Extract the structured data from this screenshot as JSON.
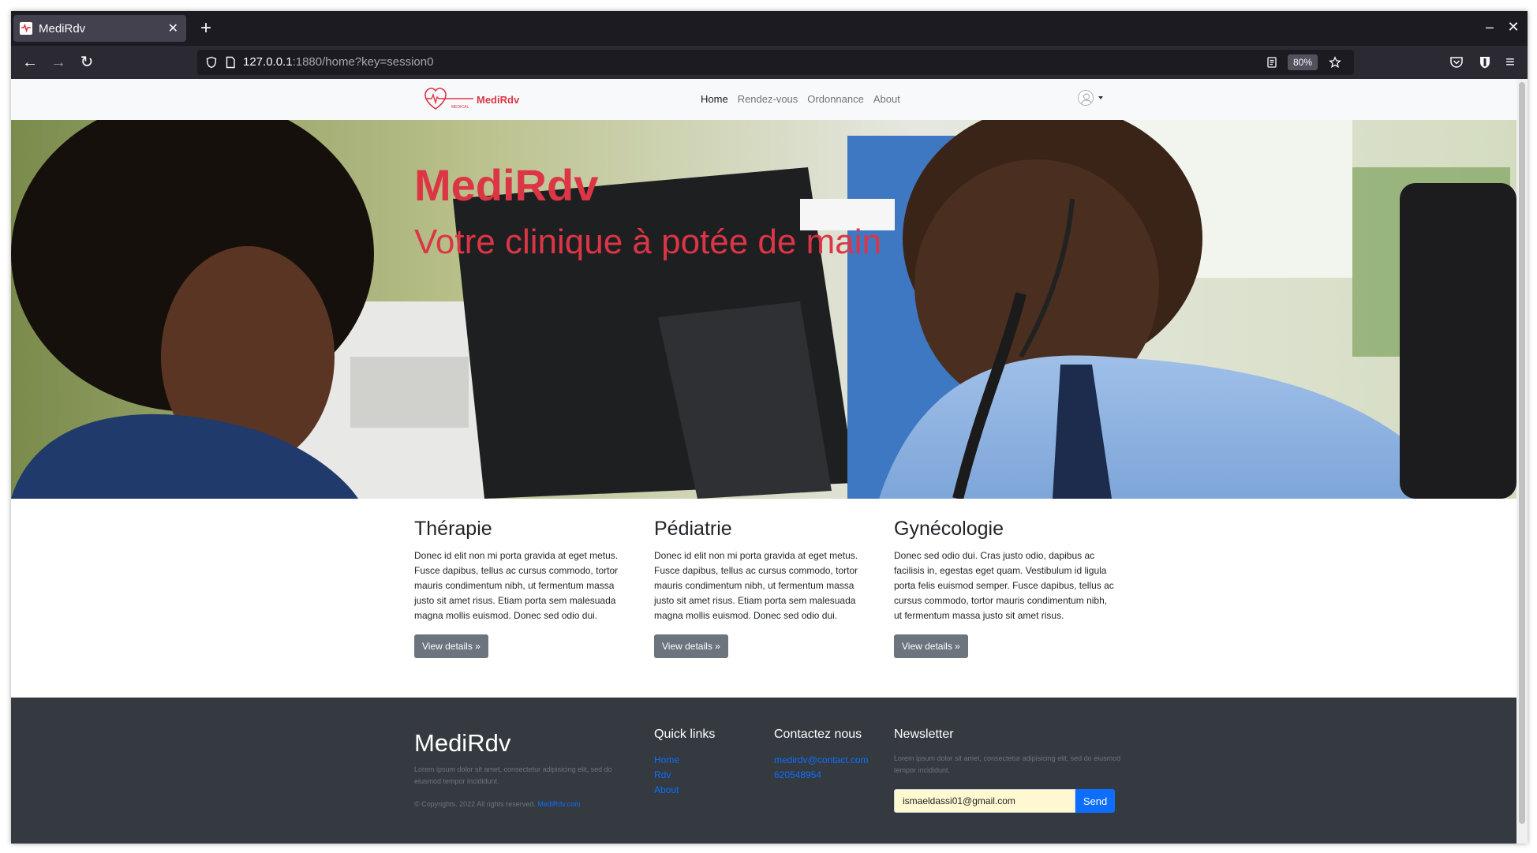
{
  "browser": {
    "tab_title": "MediRdv",
    "url_host": "127.0.0.1",
    "url_rest": ":1880/home?key=session0",
    "zoom": "80%"
  },
  "site": {
    "brand": "MediRdv",
    "brand_logo_word": "MEDICAL",
    "nav": [
      {
        "label": "Home"
      },
      {
        "label": "Rendez-vous"
      },
      {
        "label": "Ordonnance"
      },
      {
        "label": "About"
      }
    ]
  },
  "hero": {
    "title": "MediRdv",
    "subtitle": "Votre clinique à potée de main"
  },
  "features": [
    {
      "title": "Thérapie",
      "text": "Donec id elit non mi porta gravida at eget metus. Fusce dapibus, tellus ac cursus commodo, tortor mauris condimentum nibh, ut fermentum massa justo sit amet risus. Etiam porta sem malesuada magna mollis euismod. Donec sed odio dui.",
      "button": "View details »"
    },
    {
      "title": "Pédiatrie",
      "text": "Donec id elit non mi porta gravida at eget metus. Fusce dapibus, tellus ac cursus commodo, tortor mauris condimentum nibh, ut fermentum massa justo sit amet risus. Etiam porta sem malesuada magna mollis euismod. Donec sed odio dui.",
      "button": "View details »"
    },
    {
      "title": "Gynécologie",
      "text": "Donec sed odio dui. Cras justo odio, dapibus ac facilisis in, egestas eget quam. Vestibulum id ligula porta felis euismod semper. Fusce dapibus, tellus ac cursus commodo, tortor mauris condimentum nibh, ut fermentum massa justo sit amet risus.",
      "button": "View details »"
    }
  ],
  "footer": {
    "brand": "MediRdv",
    "brand_text": "Lorem ipsum dolor sit amet, consectetur adipisicing elit, sed do eiusmod tempor incididunt.",
    "copyright": "© Copyrights. 2022 All rights reserved.",
    "copyright_link": "MediRdv.com",
    "quick_links_title": "Quick links",
    "quick_links": [
      "Home",
      "Rdv",
      "About"
    ],
    "contact_title": "Contactez nous",
    "contact_email": "medirdv@contact.com",
    "contact_phone": "620548954",
    "newsletter_title": "Newsletter",
    "newsletter_text": "Lorem ipsum dolor sit amet, consectetur adipisicing elit, sed do eiusmod tempor incididunt.",
    "newsletter_value": "ismaeldassi01@gmail.com",
    "newsletter_button": "Send"
  }
}
